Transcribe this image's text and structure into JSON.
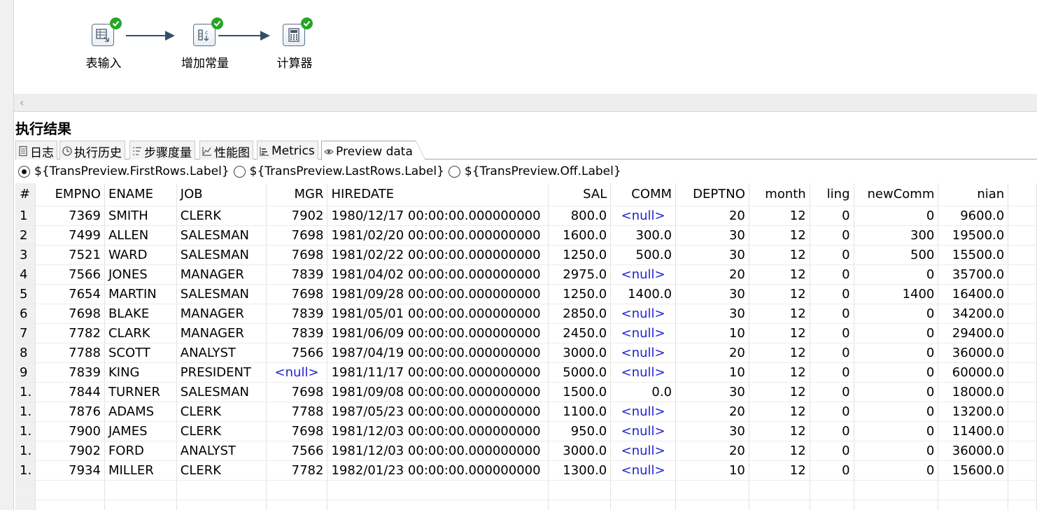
{
  "canvas": {
    "steps": [
      {
        "label": "表输入",
        "icon": "table-input-icon"
      },
      {
        "label": "增加常量",
        "icon": "add-constants-icon"
      },
      {
        "label": "计算器",
        "icon": "calculator-icon"
      }
    ]
  },
  "panel": {
    "title": "执行结果",
    "tabs": [
      {
        "label": "日志",
        "icon": "log-icon"
      },
      {
        "label": "执行历史",
        "icon": "history-icon"
      },
      {
        "label": "步骤度量",
        "icon": "step-metrics-icon"
      },
      {
        "label": "性能图",
        "icon": "performance-chart-icon"
      },
      {
        "label": "Metrics",
        "icon": "metrics-icon"
      },
      {
        "label": "Preview data",
        "icon": "eye-icon",
        "active": true
      }
    ],
    "radios": [
      {
        "label": "${TransPreview.FirstRows.Label}",
        "selected": true
      },
      {
        "label": "${TransPreview.LastRows.Label}",
        "selected": false
      },
      {
        "label": "${TransPreview.Off.Label}",
        "selected": false
      }
    ]
  },
  "table": {
    "columns": [
      "#",
      "EMPNO",
      "ENAME",
      "JOB",
      "MGR",
      "HIREDATE",
      "SAL",
      "COMM",
      "DEPTNO",
      "month",
      "ling",
      "newComm",
      "nian"
    ],
    "rows": [
      [
        "1",
        "7369",
        "SMITH",
        "CLERK",
        "7902",
        "1980/12/17 00:00:00.000000000",
        "800.0",
        "<null>",
        "20",
        "12",
        "0",
        "0",
        "9600.0"
      ],
      [
        "2",
        "7499",
        "ALLEN",
        "SALESMAN",
        "7698",
        "1981/02/20 00:00:00.000000000",
        "1600.0",
        "300.0",
        "30",
        "12",
        "0",
        "300",
        "19500.0"
      ],
      [
        "3",
        "7521",
        "WARD",
        "SALESMAN",
        "7698",
        "1981/02/22 00:00:00.000000000",
        "1250.0",
        "500.0",
        "30",
        "12",
        "0",
        "500",
        "15500.0"
      ],
      [
        "4",
        "7566",
        "JONES",
        "MANAGER",
        "7839",
        "1981/04/02 00:00:00.000000000",
        "2975.0",
        "<null>",
        "20",
        "12",
        "0",
        "0",
        "35700.0"
      ],
      [
        "5",
        "7654",
        "MARTIN",
        "SALESMAN",
        "7698",
        "1981/09/28 00:00:00.000000000",
        "1250.0",
        "1400.0",
        "30",
        "12",
        "0",
        "1400",
        "16400.0"
      ],
      [
        "6",
        "7698",
        "BLAKE",
        "MANAGER",
        "7839",
        "1981/05/01 00:00:00.000000000",
        "2850.0",
        "<null>",
        "30",
        "12",
        "0",
        "0",
        "34200.0"
      ],
      [
        "7",
        "7782",
        "CLARK",
        "MANAGER",
        "7839",
        "1981/06/09 00:00:00.000000000",
        "2450.0",
        "<null>",
        "10",
        "12",
        "0",
        "0",
        "29400.0"
      ],
      [
        "8",
        "7788",
        "SCOTT",
        "ANALYST",
        "7566",
        "1987/04/19 00:00:00.000000000",
        "3000.0",
        "<null>",
        "20",
        "12",
        "0",
        "0",
        "36000.0"
      ],
      [
        "9",
        "7839",
        "KING",
        "PRESIDENT",
        "<null>",
        "1981/11/17 00:00:00.000000000",
        "5000.0",
        "<null>",
        "10",
        "12",
        "0",
        "0",
        "60000.0"
      ],
      [
        "1.",
        "7844",
        "TURNER",
        "SALESMAN",
        "7698",
        "1981/09/08 00:00:00.000000000",
        "1500.0",
        "0.0",
        "30",
        "12",
        "0",
        "0",
        "18000.0"
      ],
      [
        "1.",
        "7876",
        "ADAMS",
        "CLERK",
        "7788",
        "1987/05/23 00:00:00.000000000",
        "1100.0",
        "<null>",
        "20",
        "12",
        "0",
        "0",
        "13200.0"
      ],
      [
        "1.",
        "7900",
        "JAMES",
        "CLERK",
        "7698",
        "1981/12/03 00:00:00.000000000",
        "950.0",
        "<null>",
        "30",
        "12",
        "0",
        "0",
        "11400.0"
      ],
      [
        "1.",
        "7902",
        "FORD",
        "ANALYST",
        "7566",
        "1981/12/03 00:00:00.000000000",
        "3000.0",
        "<null>",
        "20",
        "12",
        "0",
        "0",
        "36000.0"
      ],
      [
        "1.",
        "7934",
        "MILLER",
        "CLERK",
        "7782",
        "1982/01/23 00:00:00.000000000",
        "1300.0",
        "<null>",
        "10",
        "12",
        "0",
        "0",
        "15600.0"
      ]
    ]
  }
}
